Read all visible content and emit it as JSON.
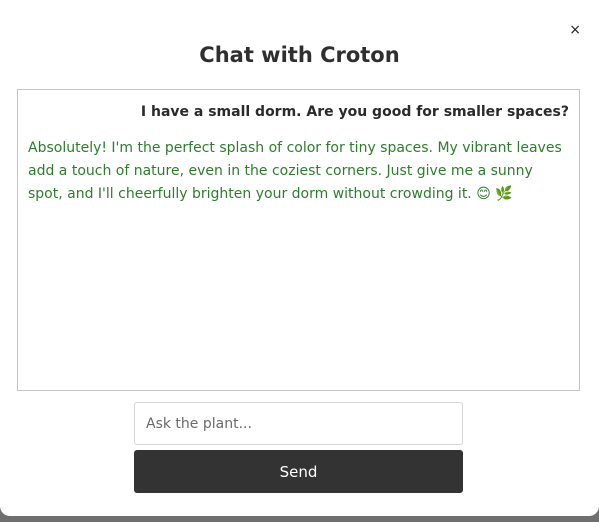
{
  "dialog": {
    "title": "Chat with Croton",
    "close_label": "×"
  },
  "chat": {
    "messages": [
      {
        "role": "user",
        "text": "I have a small dorm. Are you good for smaller spaces?"
      },
      {
        "role": "plant",
        "text": "Absolutely! I'm the perfect splash of color for tiny spaces. My vibrant leaves add a touch of nature, even in the coziest corners. Just give me a sunny spot, and I'll cheerfully brighten your dorm without crowding it. 😊 🌿"
      }
    ]
  },
  "input": {
    "placeholder": "Ask the plant...",
    "value": ""
  },
  "send_button": {
    "label": "Send"
  },
  "colors": {
    "plant_text": "#2e7d2e",
    "send_button_bg": "#333333"
  }
}
